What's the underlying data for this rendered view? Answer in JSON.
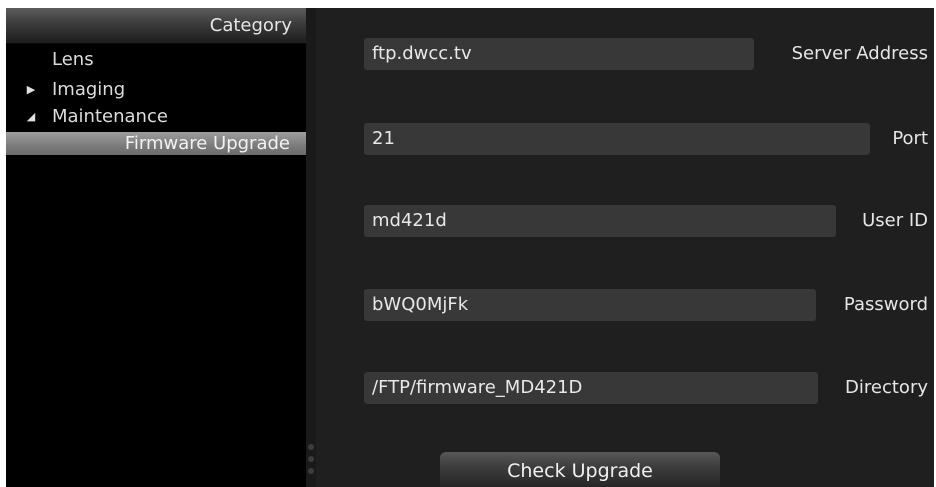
{
  "sidebar": {
    "header": "Category",
    "items": [
      {
        "label": "Lens",
        "arrow": ""
      },
      {
        "label": "Imaging",
        "arrow": "▶"
      },
      {
        "label": "Maintenance",
        "arrow": "◢"
      },
      {
        "label": "Firmware Upgrade",
        "arrow": "",
        "selected": true
      }
    ]
  },
  "form": {
    "server_address": {
      "label": "Server Address",
      "value": "ftp.dwcc.tv"
    },
    "port": {
      "label": "Port",
      "value": "21"
    },
    "user_id": {
      "label": "User ID",
      "value": "md421d"
    },
    "password": {
      "label": "Password",
      "value": "bWQ0MjFk"
    },
    "directory": {
      "label": "Directory",
      "value": "/FTP/firmware_MD421D"
    }
  },
  "actions": {
    "check_upgrade_label": "Check Upgrade"
  }
}
